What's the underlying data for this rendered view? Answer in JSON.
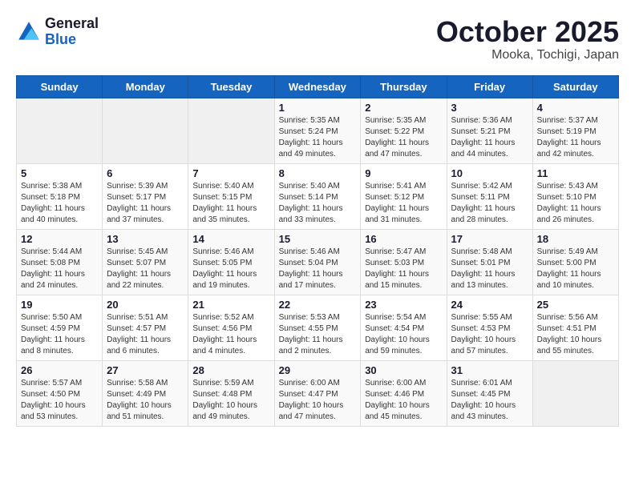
{
  "logo": {
    "line1": "General",
    "line2": "Blue"
  },
  "title": "October 2025",
  "location": "Mooka, Tochigi, Japan",
  "weekdays": [
    "Sunday",
    "Monday",
    "Tuesday",
    "Wednesday",
    "Thursday",
    "Friday",
    "Saturday"
  ],
  "weeks": [
    [
      {
        "day": "",
        "info": ""
      },
      {
        "day": "",
        "info": ""
      },
      {
        "day": "",
        "info": ""
      },
      {
        "day": "1",
        "info": "Sunrise: 5:35 AM\nSunset: 5:24 PM\nDaylight: 11 hours\nand 49 minutes."
      },
      {
        "day": "2",
        "info": "Sunrise: 5:35 AM\nSunset: 5:22 PM\nDaylight: 11 hours\nand 47 minutes."
      },
      {
        "day": "3",
        "info": "Sunrise: 5:36 AM\nSunset: 5:21 PM\nDaylight: 11 hours\nand 44 minutes."
      },
      {
        "day": "4",
        "info": "Sunrise: 5:37 AM\nSunset: 5:19 PM\nDaylight: 11 hours\nand 42 minutes."
      }
    ],
    [
      {
        "day": "5",
        "info": "Sunrise: 5:38 AM\nSunset: 5:18 PM\nDaylight: 11 hours\nand 40 minutes."
      },
      {
        "day": "6",
        "info": "Sunrise: 5:39 AM\nSunset: 5:17 PM\nDaylight: 11 hours\nand 37 minutes."
      },
      {
        "day": "7",
        "info": "Sunrise: 5:40 AM\nSunset: 5:15 PM\nDaylight: 11 hours\nand 35 minutes."
      },
      {
        "day": "8",
        "info": "Sunrise: 5:40 AM\nSunset: 5:14 PM\nDaylight: 11 hours\nand 33 minutes."
      },
      {
        "day": "9",
        "info": "Sunrise: 5:41 AM\nSunset: 5:12 PM\nDaylight: 11 hours\nand 31 minutes."
      },
      {
        "day": "10",
        "info": "Sunrise: 5:42 AM\nSunset: 5:11 PM\nDaylight: 11 hours\nand 28 minutes."
      },
      {
        "day": "11",
        "info": "Sunrise: 5:43 AM\nSunset: 5:10 PM\nDaylight: 11 hours\nand 26 minutes."
      }
    ],
    [
      {
        "day": "12",
        "info": "Sunrise: 5:44 AM\nSunset: 5:08 PM\nDaylight: 11 hours\nand 24 minutes."
      },
      {
        "day": "13",
        "info": "Sunrise: 5:45 AM\nSunset: 5:07 PM\nDaylight: 11 hours\nand 22 minutes."
      },
      {
        "day": "14",
        "info": "Sunrise: 5:46 AM\nSunset: 5:05 PM\nDaylight: 11 hours\nand 19 minutes."
      },
      {
        "day": "15",
        "info": "Sunrise: 5:46 AM\nSunset: 5:04 PM\nDaylight: 11 hours\nand 17 minutes."
      },
      {
        "day": "16",
        "info": "Sunrise: 5:47 AM\nSunset: 5:03 PM\nDaylight: 11 hours\nand 15 minutes."
      },
      {
        "day": "17",
        "info": "Sunrise: 5:48 AM\nSunset: 5:01 PM\nDaylight: 11 hours\nand 13 minutes."
      },
      {
        "day": "18",
        "info": "Sunrise: 5:49 AM\nSunset: 5:00 PM\nDaylight: 11 hours\nand 10 minutes."
      }
    ],
    [
      {
        "day": "19",
        "info": "Sunrise: 5:50 AM\nSunset: 4:59 PM\nDaylight: 11 hours\nand 8 minutes."
      },
      {
        "day": "20",
        "info": "Sunrise: 5:51 AM\nSunset: 4:57 PM\nDaylight: 11 hours\nand 6 minutes."
      },
      {
        "day": "21",
        "info": "Sunrise: 5:52 AM\nSunset: 4:56 PM\nDaylight: 11 hours\nand 4 minutes."
      },
      {
        "day": "22",
        "info": "Sunrise: 5:53 AM\nSunset: 4:55 PM\nDaylight: 11 hours\nand 2 minutes."
      },
      {
        "day": "23",
        "info": "Sunrise: 5:54 AM\nSunset: 4:54 PM\nDaylight: 10 hours\nand 59 minutes."
      },
      {
        "day": "24",
        "info": "Sunrise: 5:55 AM\nSunset: 4:53 PM\nDaylight: 10 hours\nand 57 minutes."
      },
      {
        "day": "25",
        "info": "Sunrise: 5:56 AM\nSunset: 4:51 PM\nDaylight: 10 hours\nand 55 minutes."
      }
    ],
    [
      {
        "day": "26",
        "info": "Sunrise: 5:57 AM\nSunset: 4:50 PM\nDaylight: 10 hours\nand 53 minutes."
      },
      {
        "day": "27",
        "info": "Sunrise: 5:58 AM\nSunset: 4:49 PM\nDaylight: 10 hours\nand 51 minutes."
      },
      {
        "day": "28",
        "info": "Sunrise: 5:59 AM\nSunset: 4:48 PM\nDaylight: 10 hours\nand 49 minutes."
      },
      {
        "day": "29",
        "info": "Sunrise: 6:00 AM\nSunset: 4:47 PM\nDaylight: 10 hours\nand 47 minutes."
      },
      {
        "day": "30",
        "info": "Sunrise: 6:00 AM\nSunset: 4:46 PM\nDaylight: 10 hours\nand 45 minutes."
      },
      {
        "day": "31",
        "info": "Sunrise: 6:01 AM\nSunset: 4:45 PM\nDaylight: 10 hours\nand 43 minutes."
      },
      {
        "day": "",
        "info": ""
      }
    ]
  ]
}
